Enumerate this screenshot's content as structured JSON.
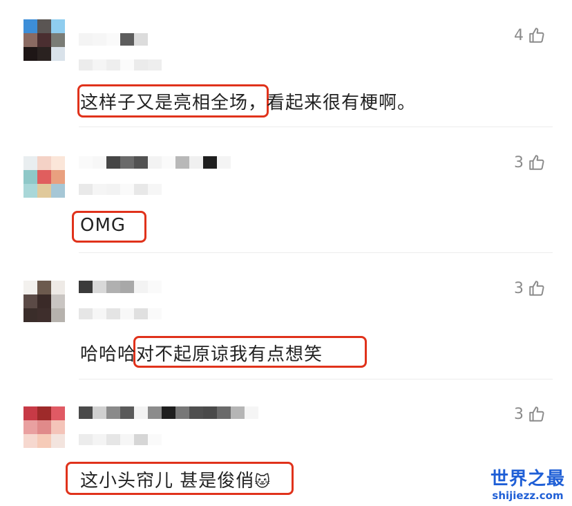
{
  "comments": [
    {
      "likes": "4",
      "text": "这样子又是亮相全场，看起来很有梗啊。",
      "highlight": "这样子又是亮相全场",
      "avatar_colors": [
        "#3d8ed8",
        "#5a5553",
        "#8fcdef",
        "#8a6a62",
        "#4a2e30",
        "#7a7c76",
        "#1e1616",
        "#2a2220",
        "#d9e2ea"
      ]
    },
    {
      "likes": "3",
      "text": "OMG",
      "highlight": "OMG",
      "avatar_colors": [
        "#e9eef0",
        "#f4d2c6",
        "#fbe6d9",
        "#8fc8c8",
        "#e05e5e",
        "#e9a07f",
        "#a9d7d8",
        "#e0c99b",
        "#a6c7d6"
      ]
    },
    {
      "likes": "3",
      "text": "哈哈哈对不起原谅我有点想笑",
      "highlight": "对不起原谅我有点想笑",
      "avatar_colors": [
        "#f3f1ee",
        "#6c5a4e",
        "#eeeae6",
        "#5b4a46",
        "#3a2a28",
        "#c9c5c2",
        "#3a2d2a",
        "#3e2e2c",
        "#b6b2ad"
      ]
    },
    {
      "likes": "3",
      "text": "这小头帘儿 甚是俊俏",
      "highlight": "这小头帘儿 甚是俊俏",
      "emoji": "🐱",
      "avatar_colors": [
        "#c73a46",
        "#9e2a2a",
        "#e05a64",
        "#e9a0a0",
        "#e08a8a",
        "#f4c4b9",
        "#f6d8cf",
        "#f6cbb8",
        "#f3e4de"
      ]
    }
  ],
  "watermark": {
    "title": "世界之最",
    "url": "shijiezz.com"
  },
  "colors": {
    "highlight_border": "#e0321b",
    "like_gray": "#8a8a8a",
    "brand_blue": "#1f5fd6"
  }
}
